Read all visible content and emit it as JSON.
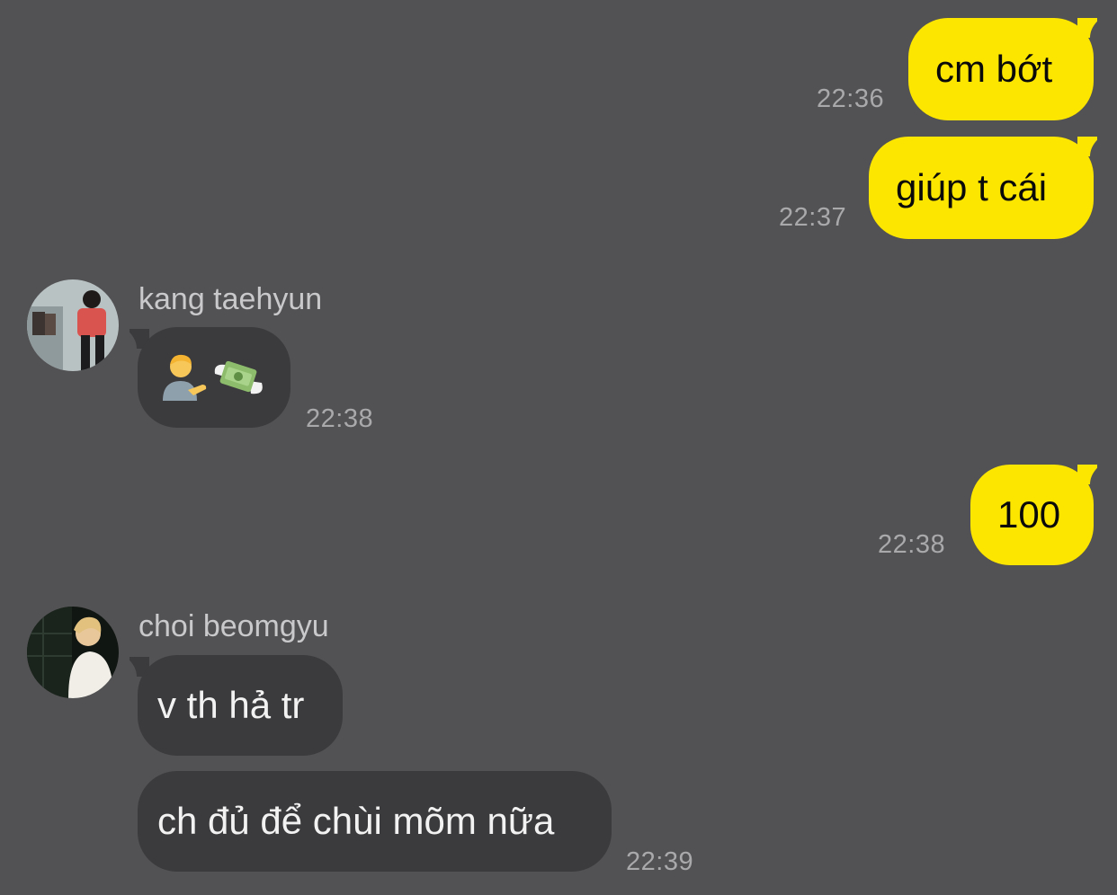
{
  "theme": {
    "background": "#525153",
    "outgoing_bubble": "#fce600",
    "incoming_bubble": "#3b3a3c"
  },
  "messages": {
    "m1": {
      "text": "cm bớt",
      "time": "22:36"
    },
    "m2": {
      "text": "giúp t cái",
      "time": "22:37"
    },
    "m3": {
      "sender": "kang taehyun",
      "emoji": [
        "person-tipping-hand",
        "money-with-wings"
      ],
      "time": "22:38"
    },
    "m4": {
      "text": "100",
      "time": "22:38"
    },
    "m5": {
      "sender": "choi beomgyu",
      "text": "v th hả tr"
    },
    "m6": {
      "text": "ch đủ để chùi mõm nữa",
      "time": "22:39"
    }
  }
}
